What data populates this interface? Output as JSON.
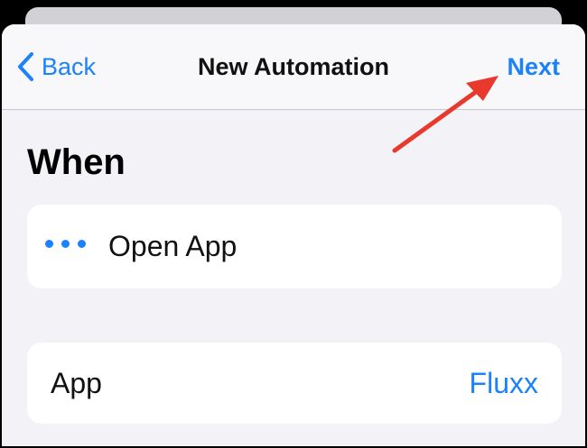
{
  "navbar": {
    "back_label": "Back",
    "title": "New Automation",
    "next_label": "Next"
  },
  "section": {
    "title": "When"
  },
  "trigger": {
    "icon": "more-dots-icon",
    "label": "Open App"
  },
  "app_row": {
    "label": "App",
    "value": "Fluxx"
  },
  "colors": {
    "accent": "#1a82fb",
    "annotation_arrow": "#e8392c",
    "background": "#f2f2f7"
  }
}
